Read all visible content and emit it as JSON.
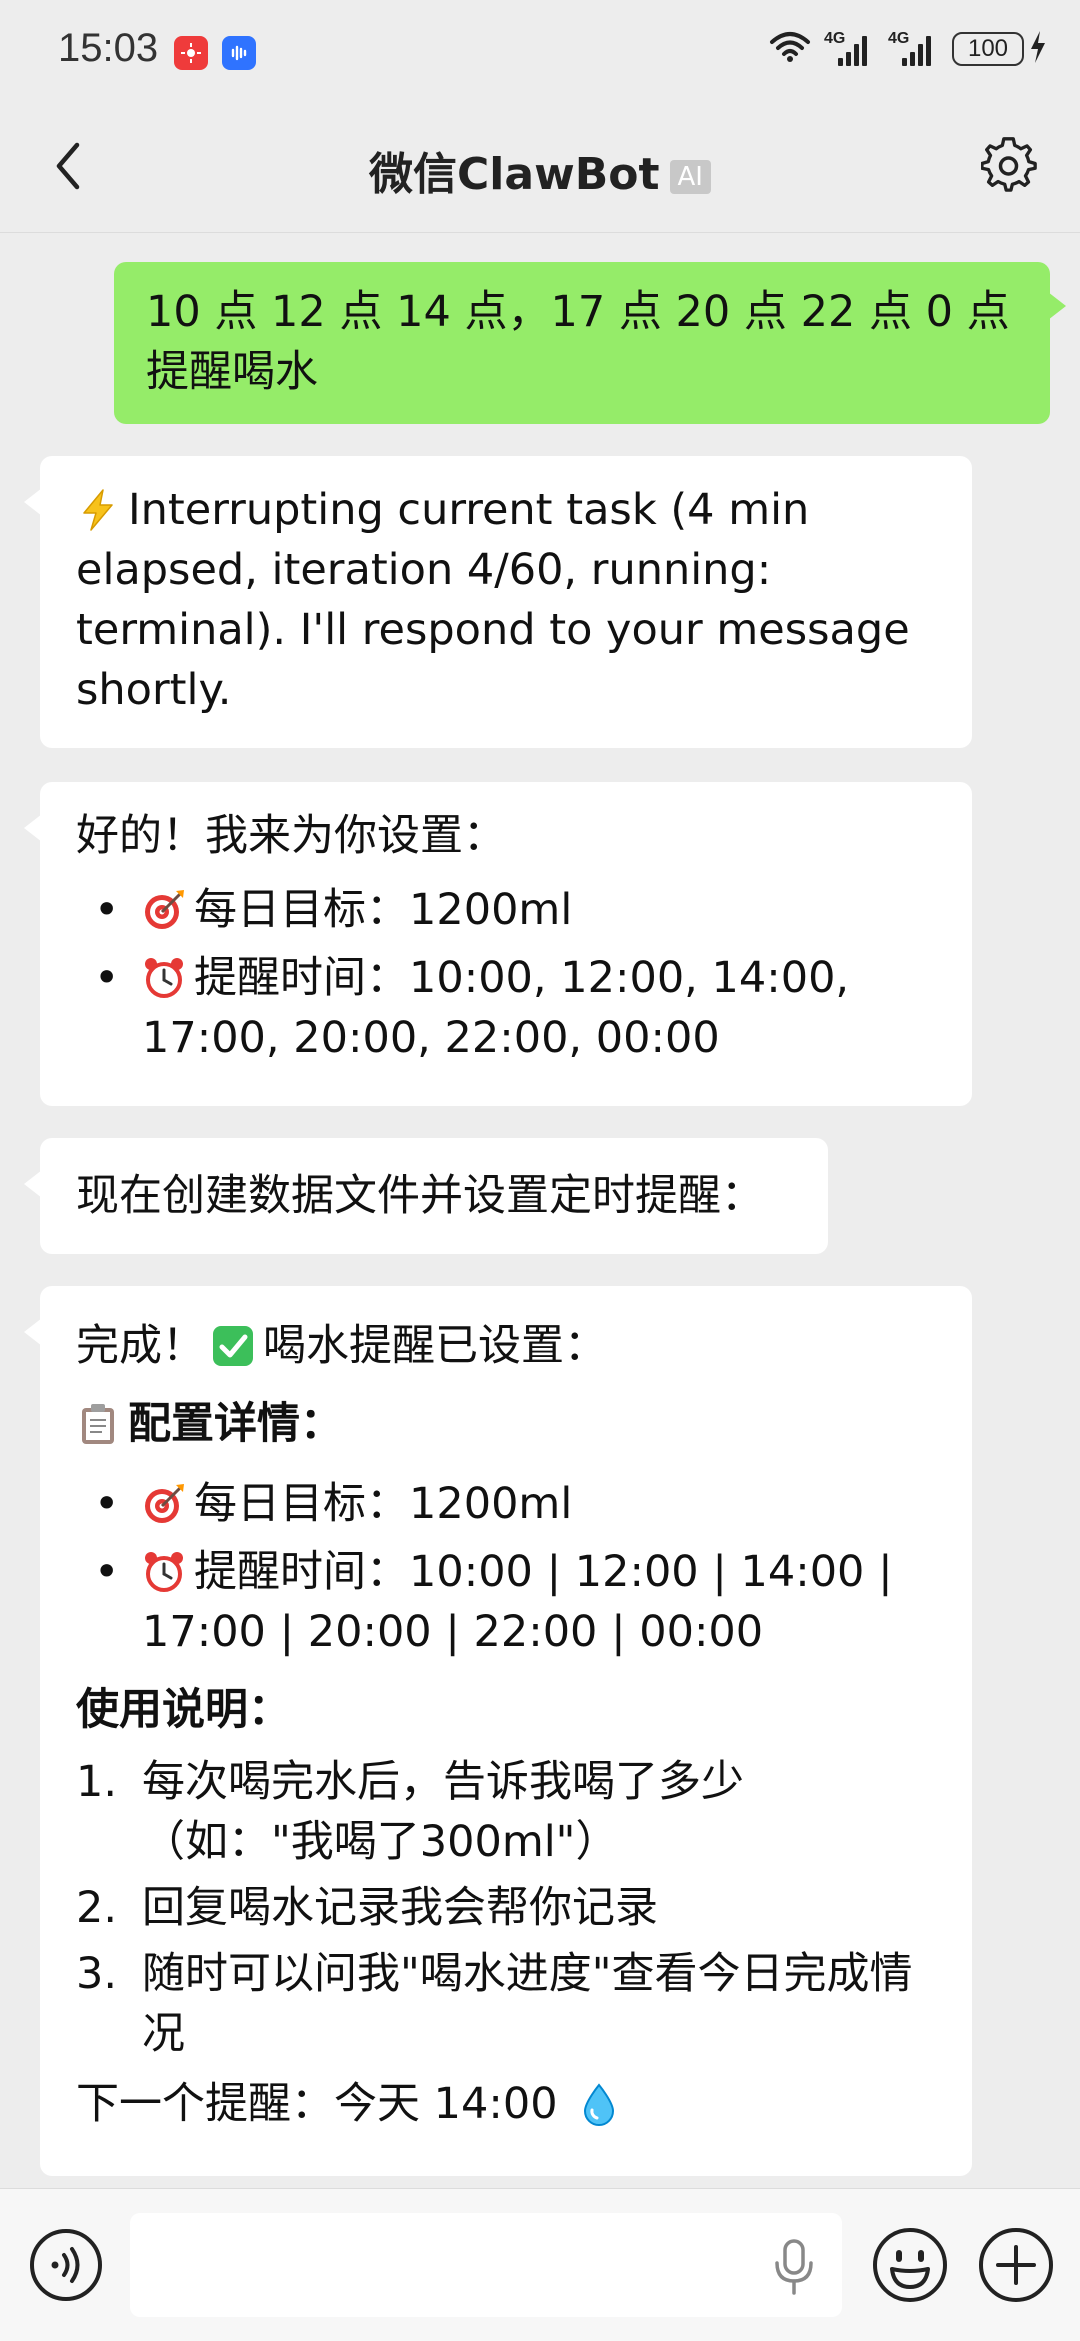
{
  "status_bar": {
    "time": "15:03",
    "signal1_label": "4G",
    "signal2_label": "4G",
    "battery": "100"
  },
  "header": {
    "title": "微信ClawBot",
    "badge": "AI"
  },
  "messages": {
    "user1": {
      "text": "10 点 12 点 14 点，17 点 20 点 22 点 0 点提醒喝水"
    },
    "bot1": {
      "line1": "Interrupting current task (4 min",
      "line2": "elapsed, iteration 4/60, running:",
      "line3": "terminal). I'll respond to your message",
      "line4": "shortly."
    },
    "bot2": {
      "intro": "好的！我来为你设置：",
      "goal_label": "每日目标：",
      "goal_value": "1200ml",
      "time_label": "提醒时间：",
      "time_value_1": "10:00, 12:00, 14:00,",
      "time_value_2": "17:00, 20:00, 22:00, 00:00"
    },
    "bot3": {
      "text": "现在创建数据文件并设置定时提醒："
    },
    "bot4": {
      "done_prefix": "完成！",
      "done_suffix": "喝水提醒已设置：",
      "config_title": "配置详情：",
      "goal_label": "每日目标：",
      "goal_value": "1200ml",
      "time_label": "提醒时间：",
      "time_value_1": "10:00 | 12:00 | 14:00 |",
      "time_value_2": "17:00 | 20:00 | 22:00 | 00:00",
      "usage_title": "使用说明：",
      "step1_num": "1.",
      "step1_line1": "每次喝完水后，告诉我喝了多少",
      "step1_line2": "（如：\"我喝了300ml\"）",
      "step2_num": "2.",
      "step2": "回复喝水记录我会帮你记录",
      "step3_num": "3.",
      "step3_line1": "随时可以问我\"喝水进度\"查看今日完成情",
      "step3_line2": "况",
      "next_label": "下一个提醒：",
      "next_value": "今天 14:00"
    }
  },
  "colors": {
    "my_bubble": "#95ec69",
    "bot_bubble": "#ffffff",
    "background": "#ededed"
  }
}
